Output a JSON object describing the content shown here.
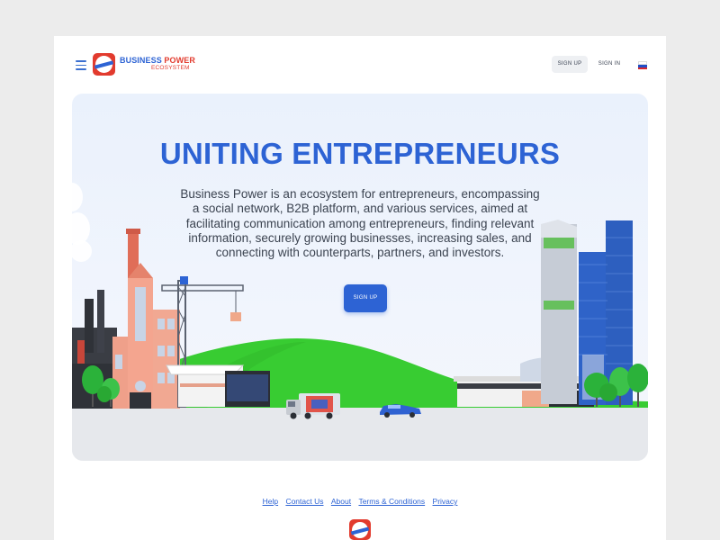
{
  "header": {
    "logo_title_a": "BUSINESS",
    "logo_title_b": "POWER",
    "logo_sub": "ECOSYSTEM",
    "signup_label": "SIGN UP",
    "signin_label": "SIGN IN",
    "language_flag": "russia-flag-icon"
  },
  "hero": {
    "title": "UNITING ENTREPRENEURS",
    "description": "Business Power is an ecosystem for entrepreneurs, encompassing a social network, B2B platform, and various services, aimed at facilitating communication among entrepreneurs, finding relevant information, securely growing businesses, increasing sales, and connecting with counterparts, partners, and investors.",
    "signup_label": "SIGN UP"
  },
  "footer": {
    "links": [
      "Help",
      "Contact Us",
      "About",
      "Terms & Conditions",
      "Privacy"
    ]
  },
  "colors": {
    "brand_blue": "#2d63d4",
    "brand_red": "#e23b2e",
    "grass_green": "#33cc33"
  }
}
